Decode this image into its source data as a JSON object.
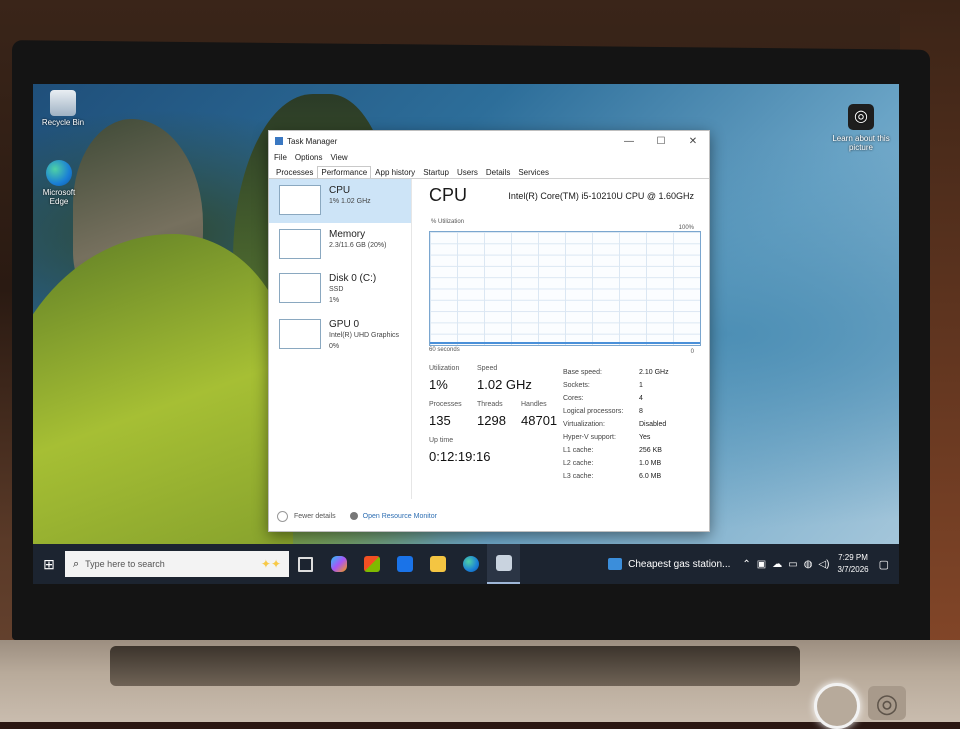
{
  "desktop": {
    "icons": [
      {
        "label": "Recycle Bin",
        "icon": "recycle-bin-icon"
      },
      {
        "label": "Microsoft Edge",
        "icon": "edge-icon"
      }
    ],
    "spotlight": {
      "label": "Learn about this picture",
      "icon": "camera-icon"
    }
  },
  "task_manager": {
    "title": "Task Manager",
    "controls": {
      "minimize": "—",
      "maximize": "☐",
      "close": "✕"
    },
    "menu": [
      "File",
      "Options",
      "View"
    ],
    "tabs": [
      "Processes",
      "Performance",
      "App history",
      "Startup",
      "Users",
      "Details",
      "Services"
    ],
    "active_tab": "Performance",
    "perf_items": [
      {
        "name": "CPU",
        "lines": [
          "1% 1.02 GHz"
        ]
      },
      {
        "name": "Memory",
        "lines": [
          "2.3/11.6 GB (20%)"
        ]
      },
      {
        "name": "Disk 0 (C:)",
        "lines": [
          "SSD",
          "1%"
        ]
      },
      {
        "name": "GPU 0",
        "lines": [
          "Intel(R) UHD Graphics",
          "0%"
        ]
      }
    ],
    "cpu": {
      "title": "CPU",
      "model": "Intel(R) Core(TM) i5-10210U CPU @ 1.60GHz",
      "util_label": "% Utilization",
      "util_max": "100%",
      "time_label": "60 seconds",
      "zero_label": "0",
      "utilization_label": "Utilization",
      "utilization": "1%",
      "speed_label": "Speed",
      "speed": "1.02 GHz",
      "processes_label": "Processes",
      "processes": "135",
      "threads_label": "Threads",
      "threads": "1298",
      "handles_label": "Handles",
      "handles": "48701",
      "uptime_label": "Up time",
      "uptime": "0:12:19:16",
      "specs": [
        {
          "label": "Base speed:",
          "value": "2.10 GHz"
        },
        {
          "label": "Sockets:",
          "value": "1"
        },
        {
          "label": "Cores:",
          "value": "4"
        },
        {
          "label": "Logical processors:",
          "value": "8"
        },
        {
          "label": "Virtualization:",
          "value": "Disabled"
        },
        {
          "label": "Hyper-V support:",
          "value": "Yes"
        },
        {
          "label": "L1 cache:",
          "value": "256 KB"
        },
        {
          "label": "L2 cache:",
          "value": "1.0 MB"
        },
        {
          "label": "L3 cache:",
          "value": "6.0 MB"
        }
      ]
    },
    "footer": {
      "fewer": "Fewer details",
      "resmon": "Open Resource Monitor"
    }
  },
  "taskbar": {
    "search_placeholder": "Type here to search",
    "news": "Cheapest gas station...",
    "tray_icons": [
      "chevron-up-icon",
      "meet-icon",
      "onedrive-icon",
      "battery-icon",
      "globe-icon",
      "speaker-icon"
    ],
    "time": "7:29 PM",
    "date": "3/7/2026",
    "colors": {
      "taskbar": "#1c2430",
      "accent": "#3b8edb"
    }
  }
}
